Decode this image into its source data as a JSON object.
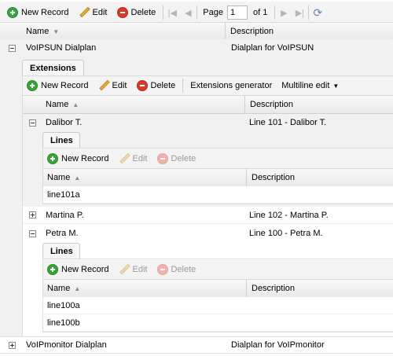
{
  "toolbar": {
    "new_record": "New Record",
    "edit": "Edit",
    "delete": "Delete",
    "page_label": "Page",
    "page_value": "1",
    "page_of": "of 1"
  },
  "grid": {
    "col_name": "Name",
    "col_description": "Description",
    "dialplans": [
      {
        "name": "VoIPSUN Dialplan",
        "description": "Dialplan for VoIPSUN"
      },
      {
        "name": "VoIPmonitor Dialplan",
        "description": "Dialplan for VoIPmonitor"
      }
    ]
  },
  "extensions": {
    "tab": "Extensions",
    "toolbar": {
      "new_record": "New Record",
      "edit": "Edit",
      "delete": "Delete",
      "generator": "Extensions generator",
      "multiline": "Multiline edit"
    },
    "col_name": "Name",
    "col_description": "Description",
    "rows": [
      {
        "name": "Dalibor T.",
        "description": "Line 101 - Dalibor T."
      },
      {
        "name": "Martina P.",
        "description": "Line 102 - Martina P."
      },
      {
        "name": "Petra M.",
        "description": "Line 100 - Petra M."
      }
    ]
  },
  "lines": {
    "tab": "Lines",
    "toolbar": {
      "new_record": "New Record",
      "edit": "Edit",
      "delete": "Delete"
    },
    "col_name": "Name",
    "col_description": "Description",
    "dalibor": [
      "line101a"
    ],
    "petra": [
      "line100a",
      "line100b"
    ]
  },
  "icons": [
    "add-icon",
    "edit-icon",
    "delete-icon",
    "first-page-icon",
    "prev-page-icon",
    "next-page-icon",
    "last-page-icon",
    "refresh-icon",
    "expand-icon",
    "collapse-icon",
    "sort-asc-icon",
    "sort-desc-icon",
    "dropdown-arrow-icon"
  ]
}
